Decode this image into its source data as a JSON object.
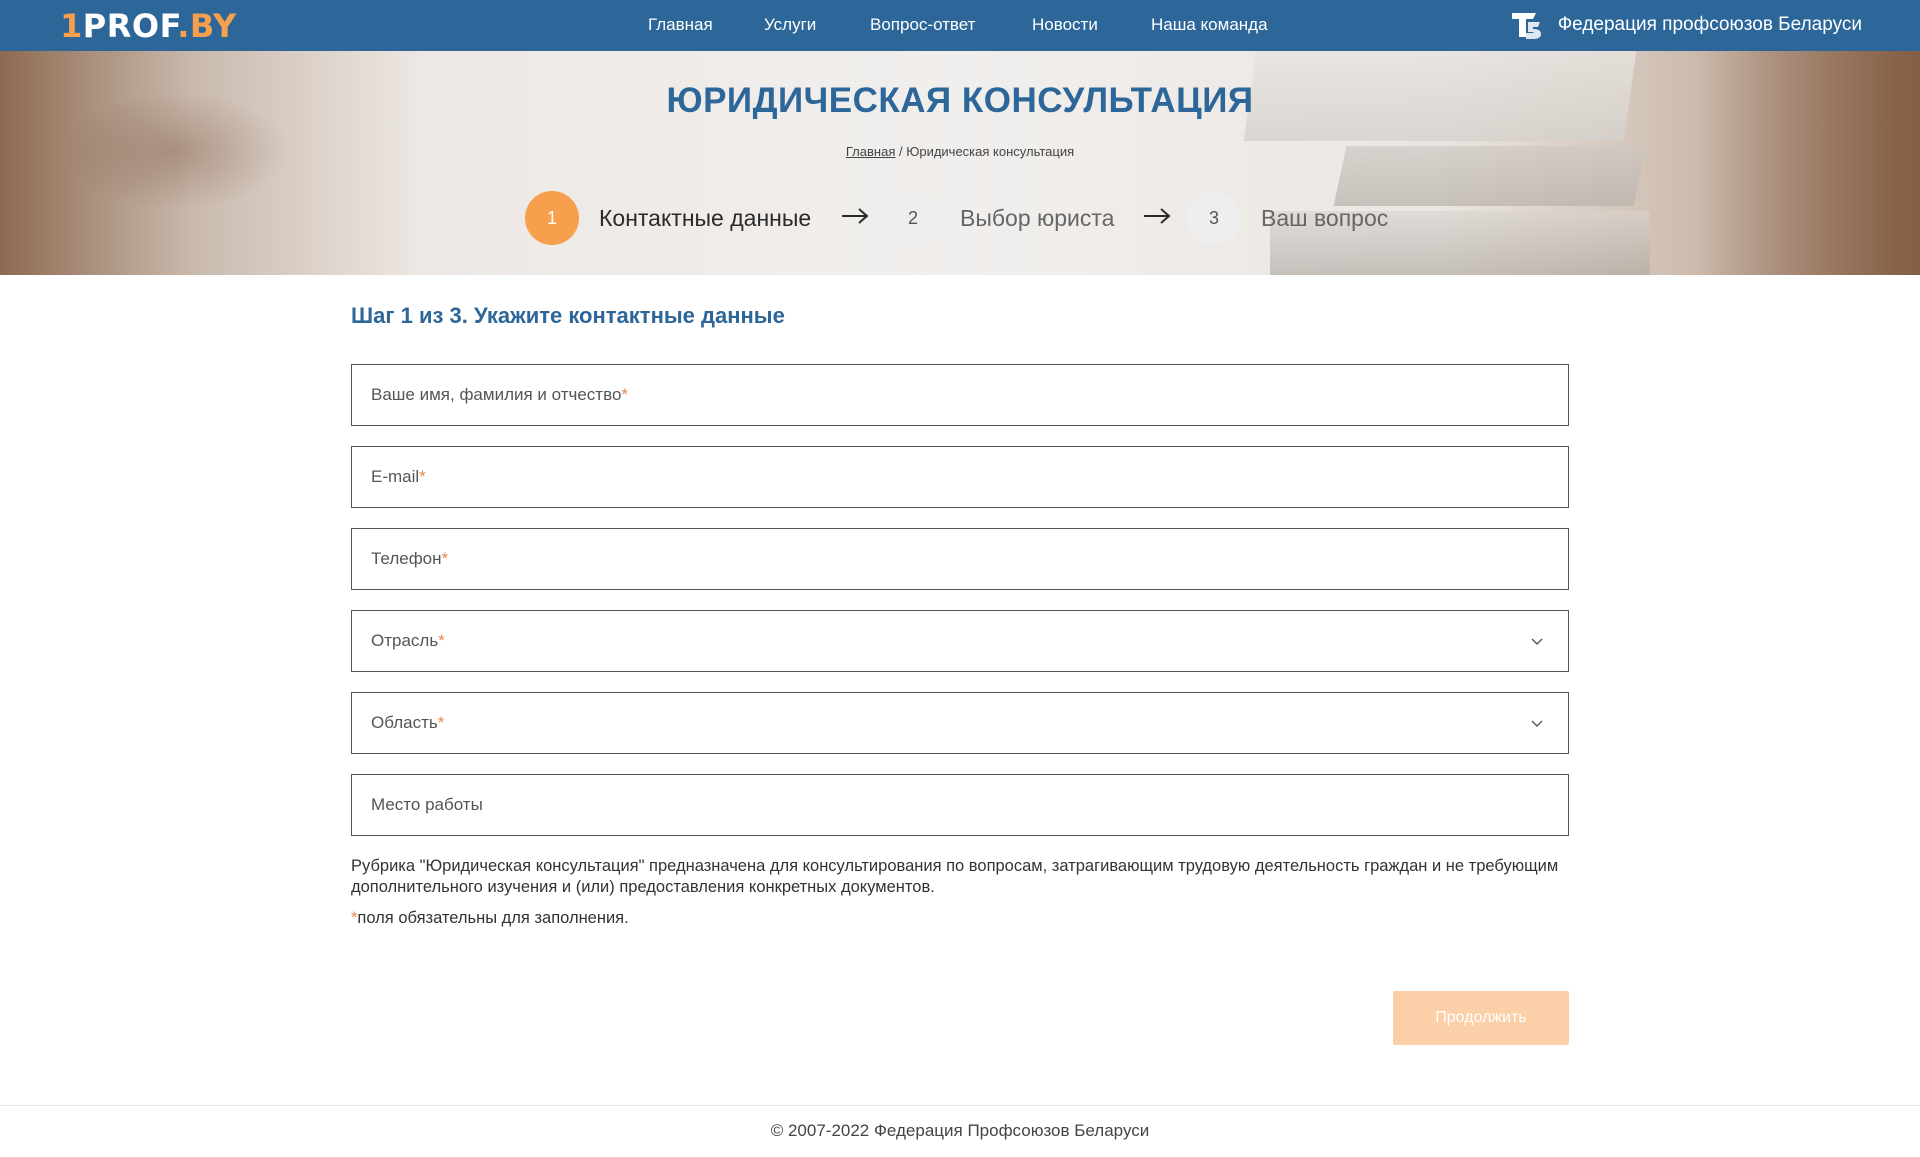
{
  "header": {
    "logo": {
      "one": "1",
      "prof": "PROF",
      "by": ".BY"
    },
    "nav": [
      "Главная",
      "Услуги",
      "Вопрос-ответ",
      "Новости",
      "Наша команда"
    ],
    "federation": "Федерация профсоюзов Беларуси",
    "federation_icon": "fpb-logo-icon"
  },
  "hero": {
    "title": "ЮРИДИЧЕСКАЯ КОНСУЛЬТАЦИЯ",
    "breadcrumb_home": "Главная",
    "breadcrumb_sep": " / ",
    "breadcrumb_current": "Юридическая консультация"
  },
  "steps": [
    {
      "number": "1",
      "label": "Контактные данные",
      "active": true
    },
    {
      "number": "2",
      "label": "Выбор юриста",
      "active": false
    },
    {
      "number": "3",
      "label": "Ваш вопрос",
      "active": false
    }
  ],
  "form": {
    "title": "Шаг 1 из 3. Укажите контактные данные",
    "fields": [
      {
        "placeholder": "Ваше имя, фамилия и отчество",
        "required": "*",
        "type": "text"
      },
      {
        "placeholder": "E-mail",
        "required": "*",
        "type": "text"
      },
      {
        "placeholder": "Телефон",
        "required": "*",
        "type": "text"
      },
      {
        "placeholder": "Отрасль",
        "required": "*",
        "type": "select"
      },
      {
        "placeholder": "Область",
        "required": "*",
        "type": "select"
      },
      {
        "placeholder": "Место работы",
        "required": "",
        "type": "text"
      }
    ],
    "note": "Рубрика \"Юридическая консультация\" предназначена для консультирования по вопросам, затрагивающим трудовую деятельность граждан и не требующим дополнительного изучения и (или) предоставления конкретных документов.",
    "required_mark": "*",
    "required_note": "поля обязательны для заполнения.",
    "submit": "Продолжить"
  },
  "footer": {
    "copyright": "© 2007-2022 Федерация Профсоюзов Беларуси"
  },
  "colors": {
    "header": "#2d6699",
    "accent": "#f6a04d",
    "button_disabled": "#fbd0a8"
  }
}
